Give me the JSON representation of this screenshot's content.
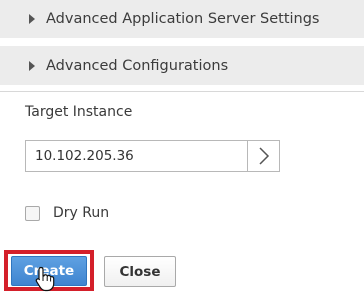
{
  "sections": [
    {
      "label": "Advanced Application Server Settings",
      "icon": "caret-right-icon"
    },
    {
      "label": "Advanced Configurations",
      "icon": "caret-right-icon"
    }
  ],
  "target_instance": {
    "label": "Target Instance",
    "value": "10.102.205.36",
    "go_icon": "chevron-right-icon"
  },
  "dry_run": {
    "label": "Dry Run",
    "checked": false
  },
  "buttons": {
    "create_label": "Create",
    "close_label": "Close"
  },
  "colors": {
    "primary_button": "#4a8fd8",
    "highlight_border": "#d41f2a",
    "section_background": "#ececec"
  },
  "cursor": "hand-pointer-icon"
}
